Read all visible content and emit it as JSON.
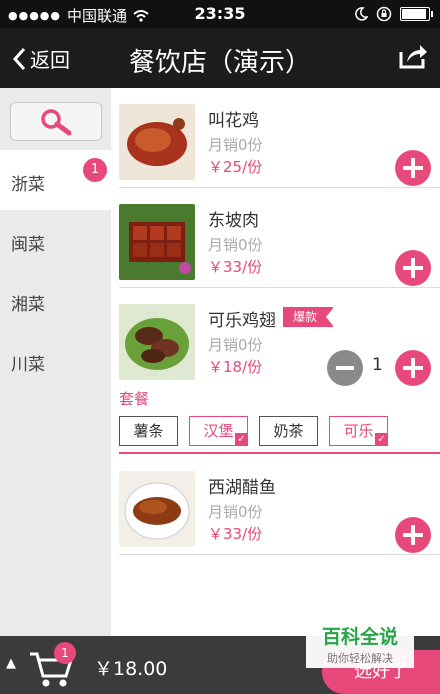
{
  "status_bar": {
    "carrier": "中国联通",
    "time": "23:35"
  },
  "nav": {
    "back_label": "返回",
    "title": "餐饮店（演示）"
  },
  "sidebar": {
    "categories": [
      {
        "label": "浙菜",
        "badge": "1"
      },
      {
        "label": "闽菜"
      },
      {
        "label": "湘菜"
      },
      {
        "label": "川菜"
      }
    ]
  },
  "dishes": [
    {
      "name": "叫花鸡",
      "sales": "月销0份",
      "price": "￥25/份"
    },
    {
      "name": "东坡肉",
      "sales": "月销0份",
      "price": "￥33/份"
    },
    {
      "name": "可乐鸡翅",
      "tag": "爆款",
      "sales": "月销0份",
      "price": "￥18/份",
      "quantity": "1"
    },
    {
      "name": "西湖醋鱼",
      "sales": "月销0份",
      "price": "￥33/份"
    }
  ],
  "combo": {
    "title": "套餐",
    "options": [
      {
        "label": "薯条",
        "selected": false
      },
      {
        "label": "汉堡",
        "selected": true
      },
      {
        "label": "奶茶",
        "selected": false
      },
      {
        "label": "可乐",
        "selected": true
      }
    ]
  },
  "cart": {
    "count": "1",
    "total": "￥18.00",
    "checkout_label": "选好了"
  },
  "watermark": {
    "title": "百科全说",
    "subtitle": "助你轻松解决"
  },
  "colors": {
    "accent": "#e8497b",
    "navbar": "#1c1c1c",
    "sidebar": "#eaeaea",
    "cartbar": "#3b3b3b"
  }
}
